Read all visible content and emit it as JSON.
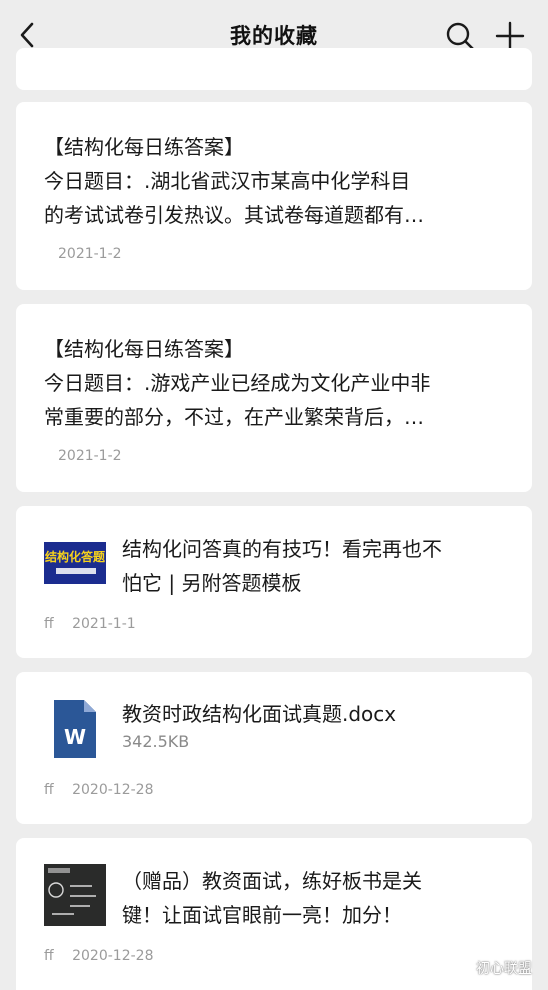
{
  "header": {
    "title": "我的收藏"
  },
  "items": [
    {
      "type": "note",
      "lines": [
        "【结构化每日练答案】",
        "今日题目：.湖北省武汉市某高中化学科目",
        "的考试试卷引发热议。其试卷每道题都有…"
      ],
      "date": "2021-1-2"
    },
    {
      "type": "note",
      "lines": [
        "【结构化每日练答案】",
        "今日题目：.游戏产业已经成为文化产业中非",
        "常重要的部分，不过，在产业繁荣背后，…"
      ],
      "date": "2021-1-2"
    },
    {
      "type": "link",
      "lines": [
        "结构化问答真的有技巧！看完再也不",
        "怕它 | 另附答题模板"
      ],
      "thumb_text": "结构化答题",
      "source": "ff",
      "date": "2021-1-1"
    },
    {
      "type": "file",
      "file_icon": "W",
      "file_name": "教资时政结构化面试真题.docx",
      "file_size": "342.5KB",
      "source": "ff",
      "date": "2020-12-28"
    },
    {
      "type": "link",
      "lines": [
        "（赠品）教资面试，练好板书是关",
        "键！让面试官眼前一亮！加分！"
      ],
      "source": "ff",
      "date": "2020-12-28"
    }
  ],
  "watermark": "初心联盟",
  "colors": {
    "background": "#ededed",
    "card": "#ffffff",
    "meta_text": "#9b9b9b",
    "word_icon": "#2b5797"
  }
}
